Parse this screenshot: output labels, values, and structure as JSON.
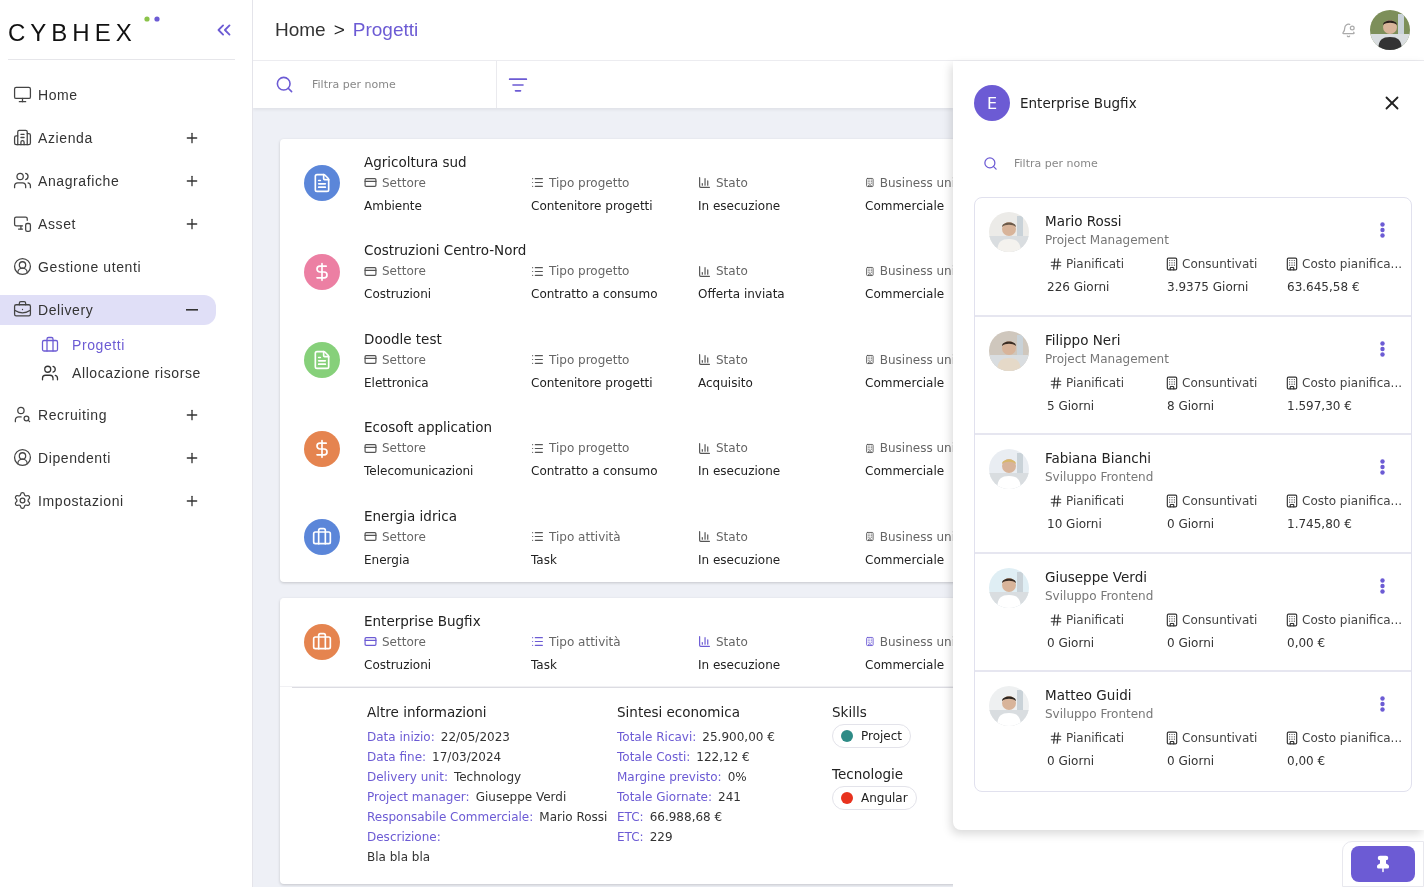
{
  "logo": {
    "text": "CYBHEX"
  },
  "sidebar": {
    "items": [
      {
        "label": "Home",
        "selected": false
      },
      {
        "label": "Azienda",
        "selected": false,
        "expanded": false
      },
      {
        "label": "Anagrafiche",
        "selected": false,
        "expanded": false
      },
      {
        "label": "Asset",
        "selected": false,
        "expanded": false
      },
      {
        "label": "Gestione utenti",
        "selected": false
      },
      {
        "label": "Delivery",
        "selected": true,
        "expanded": true,
        "children": [
          {
            "label": "Progetti",
            "selected": true
          },
          {
            "label": "Allocazione risorse",
            "selected": false
          }
        ]
      },
      {
        "label": "Recruiting",
        "selected": false,
        "expanded": false
      },
      {
        "label": "Dipendenti",
        "selected": false,
        "expanded": false
      },
      {
        "label": "Impostazioni",
        "selected": false,
        "expanded": false
      }
    ]
  },
  "breadcrumb": {
    "items": [
      "Home",
      "Progetti"
    ],
    "separator": ">"
  },
  "toolbar": {
    "search": {
      "placeholder": "Filtra per nome"
    }
  },
  "projects": [
    {
      "name": "Agricoltura sud",
      "kind": "folder",
      "color": "#5b86d9",
      "expanded": false,
      "fields": [
        {
          "label": "Settore",
          "value": "Ambiente"
        },
        {
          "label": "Tipo progetto",
          "value": "Contenitore progetti"
        },
        {
          "label": "Stato",
          "value": "In esecuzione"
        },
        {
          "label": "Business uni",
          "value": "Commerciale"
        }
      ]
    },
    {
      "name": "Costruzioni Centro-Nord",
      "kind": "dollar",
      "color": "#ec7fa3",
      "expanded": false,
      "fields": [
        {
          "label": "Settore",
          "value": "Costruzioni"
        },
        {
          "label": "Tipo progetto",
          "value": "Contratto a consumo"
        },
        {
          "label": "Stato",
          "value": "Offerta inviata"
        },
        {
          "label": "Business uni",
          "value": "Commerciale"
        }
      ]
    },
    {
      "name": "Doodle test",
      "kind": "folder",
      "color": "#86d07a",
      "expanded": false,
      "fields": [
        {
          "label": "Settore",
          "value": "Elettronica"
        },
        {
          "label": "Tipo progetto",
          "value": "Contenitore progetti"
        },
        {
          "label": "Stato",
          "value": "Acquisito"
        },
        {
          "label": "Business uni",
          "value": "Commerciale"
        }
      ]
    },
    {
      "name": "Ecosoft application",
      "kind": "dollar",
      "color": "#e5844f",
      "expanded": false,
      "fields": [
        {
          "label": "Settore",
          "value": "Telecomunicazioni"
        },
        {
          "label": "Tipo progetto",
          "value": "Contratto a consumo"
        },
        {
          "label": "Stato",
          "value": "In esecuzione"
        },
        {
          "label": "Business uni",
          "value": "Commerciale"
        }
      ]
    },
    {
      "name": "Energia idrica",
      "kind": "briefcase",
      "color": "#5b86d9",
      "expanded": false,
      "fields": [
        {
          "label": "Settore",
          "value": "Energia"
        },
        {
          "label": "Tipo attività",
          "value": "Task"
        },
        {
          "label": "Stato",
          "value": "In esecuzione"
        },
        {
          "label": "Business uni",
          "value": "Commerciale"
        }
      ]
    },
    {
      "name": "Enterprise Bugfix",
      "kind": "briefcase",
      "color": "#e5844f",
      "expanded": true,
      "fields": [
        {
          "label": "Settore",
          "value": "Costruzioni"
        },
        {
          "label": "Tipo attività",
          "value": "Task"
        },
        {
          "label": "Stato",
          "value": "In esecuzione"
        },
        {
          "label": "Business uni",
          "value": "Commerciale"
        }
      ],
      "details": {
        "sections": [
          {
            "title": "Altre informazioni",
            "rows": [
              {
                "label": "Data inizio:",
                "value": "22/05/2023"
              },
              {
                "label": "Data fine:",
                "value": "17/03/2024"
              },
              {
                "label": "Delivery unit:",
                "value": "Technology"
              },
              {
                "label": "Project manager:",
                "value": "Giuseppe Verdi"
              },
              {
                "label": "Responsabile Commerciale:",
                "value": "Mario Rossi"
              }
            ],
            "description": {
              "label": "Descrizione:",
              "value": "Bla bla bla"
            }
          },
          {
            "title": "Sintesi economica",
            "rows": [
              {
                "label": "Totale Ricavi:",
                "value": "25.900,00 €"
              },
              {
                "label": "Totale Costi:",
                "value": "122,12 €"
              },
              {
                "label": "Margine previsto:",
                "value": "0%"
              },
              {
                "label": "Totale Giornate:",
                "value": "241"
              },
              {
                "label": "ETC:",
                "value": "66.988,68 €"
              },
              {
                "label": "ETC:",
                "value": "229"
              }
            ]
          }
        ],
        "tags": [
          {
            "title": "Skills",
            "chips": [
              {
                "label": "Project",
                "color": "#2e8b86"
              }
            ]
          },
          {
            "title": "Tecnologie",
            "chips": [
              {
                "label": "Angular",
                "color": "#e8321e"
              }
            ]
          }
        ]
      }
    }
  ],
  "drawer": {
    "avatar_letter": "E",
    "title": "Enterprise Bugfix",
    "search": {
      "placeholder": "Filtra per nome"
    },
    "members": [
      {
        "name": "Mario Rossi",
        "role": "Project Management",
        "stats": [
          {
            "label": "Pianificati",
            "value": "226 Giorni"
          },
          {
            "label": "Consuntivati",
            "value": "3.9375 Giorni"
          },
          {
            "label": "Costo pianifica...",
            "value": "63.645,58 €"
          }
        ]
      },
      {
        "name": "Filippo Neri",
        "role": "Project Management",
        "stats": [
          {
            "label": "Pianificati",
            "value": "5 Giorni"
          },
          {
            "label": "Consuntivati",
            "value": "8 Giorni"
          },
          {
            "label": "Costo pianifica...",
            "value": "1.597,30 €"
          }
        ]
      },
      {
        "name": "Fabiana Bianchi",
        "role": "Sviluppo Frontend",
        "stats": [
          {
            "label": "Pianificati",
            "value": "10 Giorni"
          },
          {
            "label": "Consuntivati",
            "value": "0 Giorni"
          },
          {
            "label": "Costo pianifica...",
            "value": "1.745,80 €"
          }
        ]
      },
      {
        "name": "Giuseppe Verdi",
        "role": "Sviluppo Frontend",
        "stats": [
          {
            "label": "Pianificati",
            "value": "0 Giorni"
          },
          {
            "label": "Consuntivati",
            "value": "0 Giorni"
          },
          {
            "label": "Costo pianifica...",
            "value": "0,00 €"
          }
        ]
      },
      {
        "name": "Matteo Guidi",
        "role": "Sviluppo Frontend",
        "stats": [
          {
            "label": "Pianificati",
            "value": "0 Giorni"
          },
          {
            "label": "Consuntivati",
            "value": "0 Giorni"
          },
          {
            "label": "Costo pianifica...",
            "value": "0,00 €"
          }
        ]
      }
    ]
  }
}
